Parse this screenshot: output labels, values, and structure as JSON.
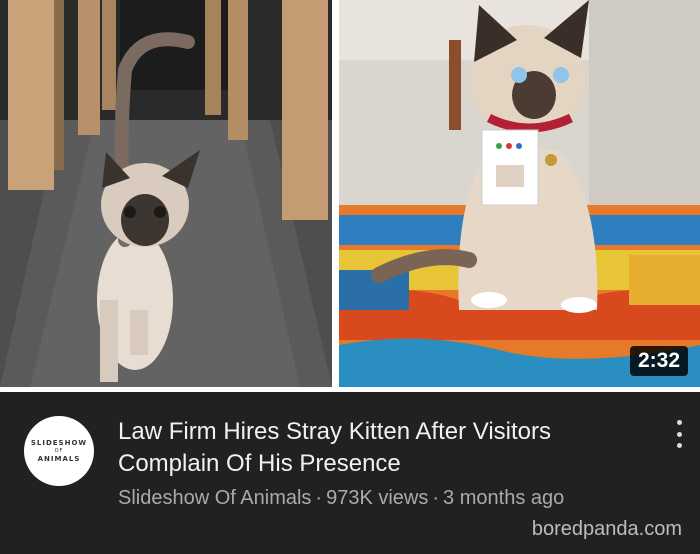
{
  "video": {
    "duration": "2:32",
    "title": "Law Firm Hires Stray Kitten After Visitors Complain Of His Presence",
    "channel": "Slideshow Of Animals",
    "views": "973K views",
    "age": "3 months ago",
    "separator": "·"
  },
  "avatar": {
    "line1": "SLIDESHOW",
    "line2": "OF",
    "line3": "ANIMALS"
  },
  "watermark": "boredpanda.com",
  "colors": {
    "background": "#212121",
    "title": "#f1f1f1",
    "meta": "#aaaaaa"
  },
  "icons": {
    "menu": "more-vert-icon"
  }
}
